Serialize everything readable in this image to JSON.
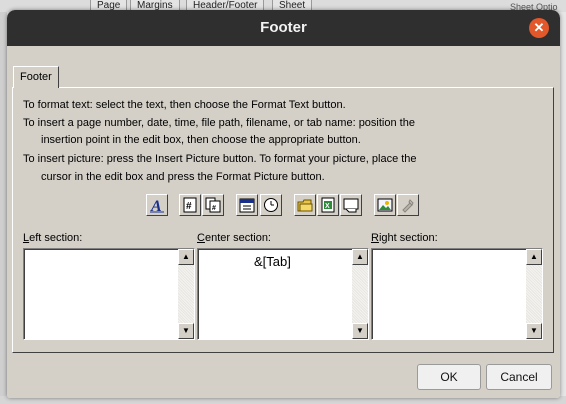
{
  "background": {
    "tabs": [
      "Page",
      "Margins",
      "Header/Footer",
      "Sheet"
    ],
    "right_text": "Sheet Optio"
  },
  "window": {
    "title": "Footer",
    "close_icon": "close-icon"
  },
  "tab": {
    "label": "Footer"
  },
  "instructions": {
    "line1": "To format text:  select the text, then choose the Format Text button.",
    "line2": "To insert a page number, date, time, file path, filename, or tab name:  position the",
    "line3": "insertion point in the edit box, then choose the appropriate button.",
    "line4": "To insert picture: press the Insert Picture button.  To format your picture, place the",
    "line5": "cursor in the edit box and press the Format Picture button."
  },
  "toolbar": [
    {
      "name": "format-text",
      "icon": "format-text-icon"
    },
    {
      "name": "insert-page-number",
      "icon": "page-number-icon"
    },
    {
      "name": "insert-number-of-pages",
      "icon": "number-of-pages-icon"
    },
    {
      "name": "insert-date",
      "icon": "date-icon"
    },
    {
      "name": "insert-time",
      "icon": "time-icon"
    },
    {
      "name": "insert-file-path",
      "icon": "file-path-icon"
    },
    {
      "name": "insert-file-name",
      "icon": "file-name-icon"
    },
    {
      "name": "insert-sheet-name",
      "icon": "sheet-name-icon"
    },
    {
      "name": "insert-picture",
      "icon": "picture-icon"
    },
    {
      "name": "format-picture",
      "icon": "format-picture-icon"
    }
  ],
  "sections": {
    "left": {
      "label_accel": "L",
      "label_rest": "eft section:",
      "value": ""
    },
    "center": {
      "label_accel": "C",
      "label_rest": "enter section:",
      "value": "&[Tab]"
    },
    "right": {
      "label_accel": "R",
      "label_rest": "ight section:",
      "value": ""
    }
  },
  "buttons": {
    "ok": "OK",
    "cancel": "Cancel"
  },
  "colors": {
    "titlebar": "#2f2f2f",
    "close": "#e2582b",
    "dialog": "#d4d0c8"
  }
}
